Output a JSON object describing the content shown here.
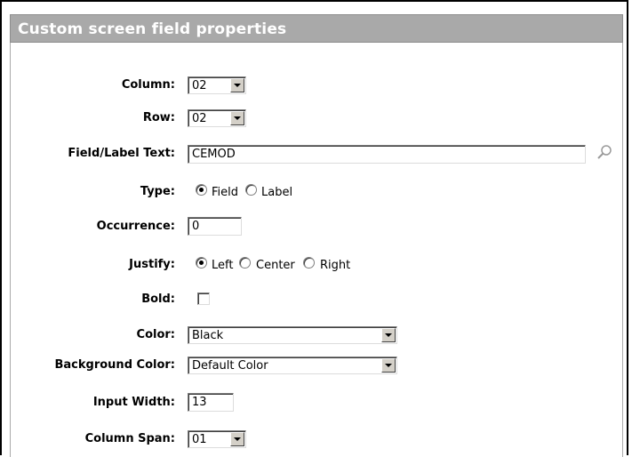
{
  "panel": {
    "title": "Custom screen field properties"
  },
  "fields": {
    "column": {
      "label": "Column:",
      "value": "02"
    },
    "row": {
      "label": "Row:",
      "value": "02"
    },
    "field_label_text": {
      "label": "Field/Label Text:",
      "value": "CEMOD"
    },
    "type": {
      "label": "Type:",
      "options": [
        "Field",
        "Label"
      ],
      "selected": "Field"
    },
    "occurrence": {
      "label": "Occurrence:",
      "value": "0"
    },
    "justify": {
      "label": "Justify:",
      "options": [
        "Left",
        "Center",
        "Right"
      ],
      "selected": "Left"
    },
    "bold": {
      "label": "Bold:",
      "checked": false
    },
    "color": {
      "label": "Color:",
      "value": "Black"
    },
    "background_color": {
      "label": "Background Color:",
      "value": "Default Color"
    },
    "input_width": {
      "label": "Input Width:",
      "value": "13"
    },
    "column_span": {
      "label": "Column Span:",
      "value": "01"
    }
  },
  "icons": {
    "lookup": "magnifier-icon"
  },
  "colors": {
    "header_bg": "#a9a9a9",
    "header_text": "#ffffff"
  }
}
